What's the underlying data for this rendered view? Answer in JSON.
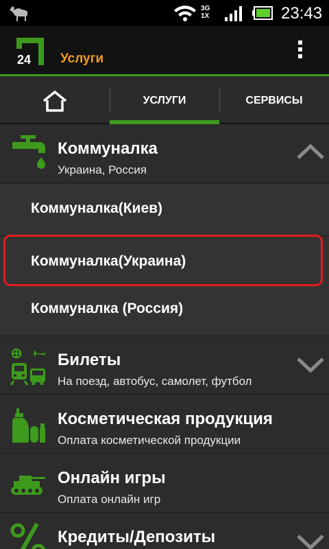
{
  "status_bar": {
    "network_top": "3G",
    "network_bottom": "1X",
    "time": "23:43",
    "icons": [
      "camel-icon",
      "wifi-icon",
      "signal-icon",
      "battery-icon"
    ]
  },
  "action_bar": {
    "logo_text": "24",
    "title": "Услуги"
  },
  "tabs": [
    {
      "icon": "home-icon"
    },
    {
      "label": "УСЛУГИ",
      "selected": true
    },
    {
      "label": "СЕРВИСЫ",
      "selected": false
    }
  ],
  "categories": [
    {
      "title": "Коммуналка",
      "subtitle": "Украина, Россия",
      "icon": "water-tap-icon",
      "expanded": true,
      "items": [
        "Коммуналка(Киев)",
        "Коммуналка(Украина)",
        "Коммуналка (Россия)"
      ]
    },
    {
      "title": "Билеты",
      "subtitle": "На поезд, автобус, самолет, футбол",
      "icon": "tickets-icon",
      "expanded": false
    },
    {
      "title": "Косметическая продукция",
      "subtitle": "Оплата косметической продукции",
      "icon": "cosmetics-icon"
    },
    {
      "title": "Онлайн игры",
      "subtitle": "Оплата онлайн игр",
      "icon": "tank-icon"
    },
    {
      "title": "Кредиты/Депозиты",
      "subtitle": "",
      "icon": "percent-icon",
      "expanded": false
    }
  ],
  "colors": {
    "accent_green": "#3d9a1c",
    "title_orange": "#f39a1e",
    "highlight_red": "#e21b1b",
    "background": "#2c2c2c"
  }
}
